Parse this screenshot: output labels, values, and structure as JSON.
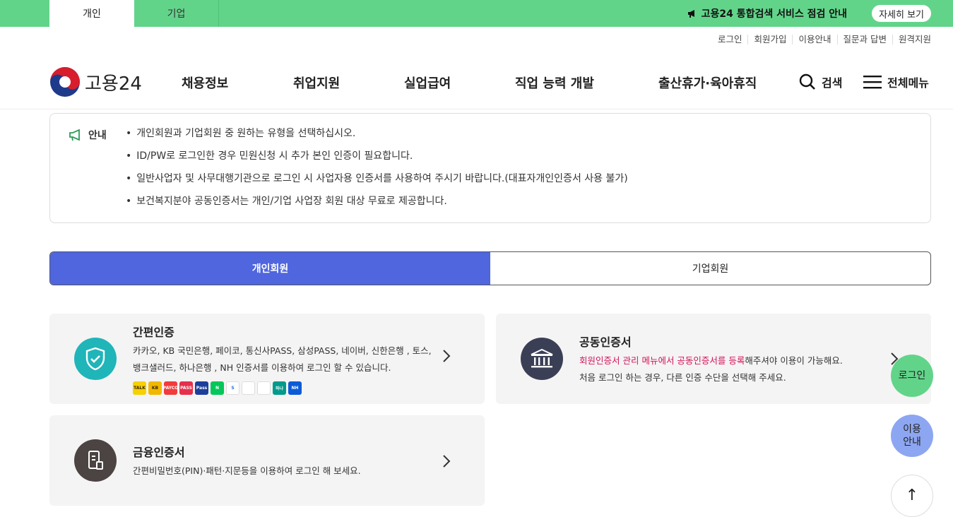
{
  "topbar": {
    "tabs": [
      "개인",
      "기업"
    ],
    "notice": "고용24 통합검색 서비스 점검 안내",
    "notice_button": "자세히 보기"
  },
  "util_links": [
    "로그인",
    "회원가입",
    "이용안내",
    "질문과 답변",
    "원격지원"
  ],
  "logo": {
    "text": "고용24"
  },
  "nav": {
    "items": [
      "채용정보",
      "취업지원",
      "실업급여",
      "직업 능력 개발",
      "출산휴가·육아휴직"
    ],
    "search": "검색",
    "all_menu": "전체메뉴"
  },
  "info": {
    "label": "안내",
    "items": [
      "개인회원과 기업회원 중 원하는 유형을 선택하십시오.",
      "ID/PW로 로그인한 경우 민원신청 시 추가 본인 인증이 필요합니다.",
      "일반사업자 및 사무대행기관으로 로그인 시 사업자용 인증서를 사용하여 주시기 바랍니다.(대표자개인인증서 사용 불가)",
      "보건복지분야 공동인증서는 개인/기업 사업장 회원 대상 무료로 제공합니다."
    ]
  },
  "member_tabs": {
    "personal": "개인회원",
    "business": "기업회원",
    "selected": "개인회원"
  },
  "cards": {
    "simple": {
      "title": "간편인증",
      "desc1": "카카오, KB 국민은행, 페이코, 통신사PASS, 삼성PASS, 네이버, 신한은행 , 토스,",
      "desc2": "뱅크샐러드, 하나은행 , NH 인증서를 이용하여 로그인 할 수 있습니다."
    },
    "joint": {
      "title": "공동인증서",
      "desc_highlight": "회원인증서 관리 메뉴에서 공동인증서를 등록",
      "desc_rest": "해주셔야 이용이 가능해요.",
      "desc2": "처음 로그인 하는 경우, 다른 인증 수단을 선택해 주세요."
    },
    "finance": {
      "title": "금융인증서",
      "desc": "간편비밀번호(PIN)·패턴·지문등을 이용하여 로그인 해 보세요."
    }
  },
  "provider_icons": [
    {
      "name": "kakao-icon",
      "label": "TALK",
      "color": "#f7d000"
    },
    {
      "name": "kb-icon",
      "label": "KB",
      "color": "#f2b800"
    },
    {
      "name": "payco-icon",
      "label": "PAYCO",
      "color": "#f23b3b"
    },
    {
      "name": "pass-icon",
      "label": "PASS",
      "color": "#e6304b"
    },
    {
      "name": "samsung-pass-icon",
      "label": "Pass",
      "color": "#1d3f9c"
    },
    {
      "name": "naver-icon",
      "label": "N",
      "color": "#03c75a"
    },
    {
      "name": "shinhan-icon",
      "label": "S",
      "color": "#ffffff"
    },
    {
      "name": "toss-icon",
      "label": "",
      "color": "#ffffff"
    },
    {
      "name": "banksalad-icon",
      "label": "",
      "color": "#ffffff"
    },
    {
      "name": "hana-icon",
      "label": "하나",
      "color": "#009b8c"
    },
    {
      "name": "nh-icon",
      "label": "NH",
      "color": "#0c5bd6"
    }
  ],
  "floating": {
    "login": "로그인",
    "guide1": "이용",
    "guide2": "안내",
    "top": "↑"
  },
  "colors": {
    "green": "#62d48a",
    "accent": "#4f66de",
    "highlight": "#d4145a"
  }
}
